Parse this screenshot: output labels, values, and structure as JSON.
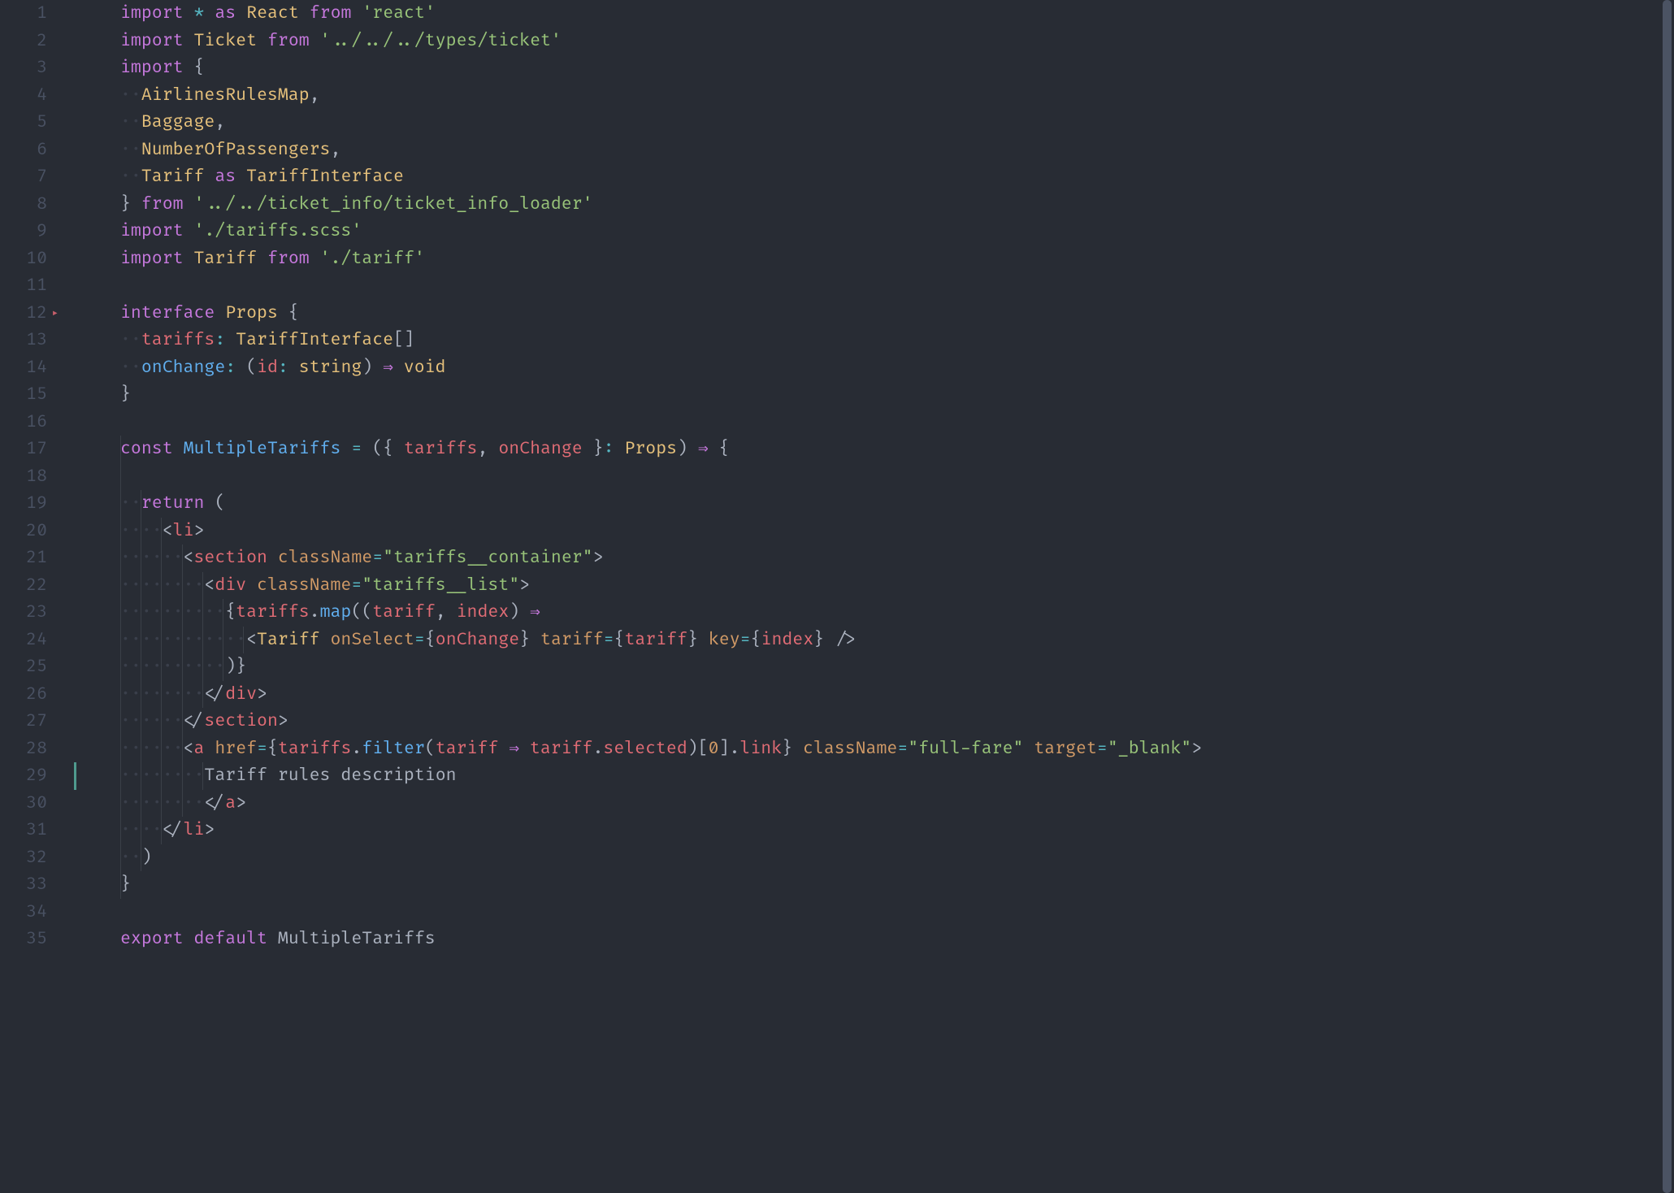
{
  "editor": {
    "first_line": 1,
    "last_line": 35,
    "gutter_marker_line": 12,
    "change_bar_line": 29,
    "indent_char": "·",
    "lines": [
      {
        "n": 1,
        "tokens": [
          [
            "kw",
            "import"
          ],
          [
            "punct",
            " "
          ],
          [
            "op",
            "*"
          ],
          [
            "punct",
            " "
          ],
          [
            "kw",
            "as"
          ],
          [
            "punct",
            " "
          ],
          [
            "type",
            "React"
          ],
          [
            "punct",
            " "
          ],
          [
            "kw",
            "from"
          ],
          [
            "punct",
            " "
          ],
          [
            "str",
            "'react'"
          ]
        ]
      },
      {
        "n": 2,
        "tokens": [
          [
            "kw",
            "import"
          ],
          [
            "punct",
            " "
          ],
          [
            "type",
            "Ticket"
          ],
          [
            "punct",
            " "
          ],
          [
            "kw",
            "from"
          ],
          [
            "punct",
            " "
          ],
          [
            "str",
            "'../../../types/ticket'"
          ]
        ]
      },
      {
        "n": 3,
        "tokens": [
          [
            "kw",
            "import"
          ],
          [
            "punct",
            " {"
          ]
        ]
      },
      {
        "n": 4,
        "indent": 2,
        "tokens": [
          [
            "type",
            "AirlinesRulesMap"
          ],
          [
            "punct",
            ","
          ]
        ]
      },
      {
        "n": 5,
        "indent": 2,
        "tokens": [
          [
            "type",
            "Baggage"
          ],
          [
            "punct",
            ","
          ]
        ]
      },
      {
        "n": 6,
        "indent": 2,
        "tokens": [
          [
            "type",
            "NumberOfPassengers"
          ],
          [
            "punct",
            ","
          ]
        ]
      },
      {
        "n": 7,
        "indent": 2,
        "tokens": [
          [
            "type",
            "Tariff"
          ],
          [
            "punct",
            " "
          ],
          [
            "kw",
            "as"
          ],
          [
            "punct",
            " "
          ],
          [
            "type",
            "TariffInterface"
          ]
        ]
      },
      {
        "n": 8,
        "tokens": [
          [
            "punct",
            "} "
          ],
          [
            "kw",
            "from"
          ],
          [
            "punct",
            " "
          ],
          [
            "str",
            "'../../ticket_info/ticket_info_loader'"
          ]
        ]
      },
      {
        "n": 9,
        "tokens": [
          [
            "kw",
            "import"
          ],
          [
            "punct",
            " "
          ],
          [
            "str",
            "'./tariffs.scss'"
          ]
        ]
      },
      {
        "n": 10,
        "tokens": [
          [
            "kw",
            "import"
          ],
          [
            "punct",
            " "
          ],
          [
            "type",
            "Tariff"
          ],
          [
            "punct",
            " "
          ],
          [
            "kw",
            "from"
          ],
          [
            "punct",
            " "
          ],
          [
            "str",
            "'./tariff'"
          ]
        ]
      },
      {
        "n": 11,
        "tokens": []
      },
      {
        "n": 12,
        "tokens": [
          [
            "kw",
            "interface"
          ],
          [
            "punct",
            " "
          ],
          [
            "type",
            "Props"
          ],
          [
            "punct",
            " {"
          ]
        ]
      },
      {
        "n": 13,
        "indent": 2,
        "tokens": [
          [
            "prop",
            "tariffs"
          ],
          [
            "op",
            ":"
          ],
          [
            "punct",
            " "
          ],
          [
            "type",
            "TariffInterface"
          ],
          [
            "punct",
            "[]"
          ]
        ]
      },
      {
        "n": 14,
        "indent": 2,
        "tokens": [
          [
            "fn",
            "onChange"
          ],
          [
            "op",
            ":"
          ],
          [
            "punct",
            " ("
          ],
          [
            "var",
            "id"
          ],
          [
            "op",
            ":"
          ],
          [
            "punct",
            " "
          ],
          [
            "type",
            "string"
          ],
          [
            "punct",
            ") "
          ],
          [
            "kw",
            "⇒"
          ],
          [
            "punct",
            " "
          ],
          [
            "type",
            "void"
          ]
        ]
      },
      {
        "n": 15,
        "tokens": [
          [
            "punct",
            "}"
          ]
        ]
      },
      {
        "n": 16,
        "tokens": []
      },
      {
        "n": 17,
        "tokens": [
          [
            "kw",
            "const"
          ],
          [
            "punct",
            " "
          ],
          [
            "fn",
            "MultipleTariffs"
          ],
          [
            "punct",
            " "
          ],
          [
            "op",
            "="
          ],
          [
            "punct",
            " ({ "
          ],
          [
            "var",
            "tariffs"
          ],
          [
            "punct",
            ", "
          ],
          [
            "var",
            "onChange"
          ],
          [
            "punct",
            " }"
          ],
          [
            "op",
            ":"
          ],
          [
            "punct",
            " "
          ],
          [
            "type",
            "Props"
          ],
          [
            "punct",
            ") "
          ],
          [
            "kw",
            "⇒"
          ],
          [
            "punct",
            " {"
          ]
        ]
      },
      {
        "n": 18,
        "tokens": []
      },
      {
        "n": 19,
        "indent": 2,
        "tokens": [
          [
            "kw",
            "return"
          ],
          [
            "punct",
            " ("
          ]
        ]
      },
      {
        "n": 20,
        "indent": 4,
        "tokens": [
          [
            "tagbr",
            "<"
          ],
          [
            "tag",
            "li"
          ],
          [
            "tagbr",
            ">"
          ]
        ]
      },
      {
        "n": 21,
        "indent": 6,
        "tokens": [
          [
            "tagbr",
            "<"
          ],
          [
            "tag",
            "section"
          ],
          [
            "punct",
            " "
          ],
          [
            "attr",
            "className"
          ],
          [
            "op",
            "="
          ],
          [
            "str",
            "\"tariffs__container\""
          ],
          [
            "tagbr",
            ">"
          ]
        ]
      },
      {
        "n": 22,
        "indent": 8,
        "tokens": [
          [
            "tagbr",
            "<"
          ],
          [
            "tag",
            "div"
          ],
          [
            "punct",
            " "
          ],
          [
            "attr",
            "className"
          ],
          [
            "op",
            "="
          ],
          [
            "str",
            "\"tariffs__list\""
          ],
          [
            "tagbr",
            ">"
          ]
        ]
      },
      {
        "n": 23,
        "indent": 10,
        "tokens": [
          [
            "punct",
            "{"
          ],
          [
            "var",
            "tariffs"
          ],
          [
            "punct",
            "."
          ],
          [
            "fn",
            "map"
          ],
          [
            "punct",
            "(("
          ],
          [
            "var",
            "tariff"
          ],
          [
            "punct",
            ", "
          ],
          [
            "var",
            "index"
          ],
          [
            "punct",
            ") "
          ],
          [
            "kw",
            "⇒"
          ]
        ]
      },
      {
        "n": 24,
        "indent": 12,
        "tokens": [
          [
            "tagbr",
            "<"
          ],
          [
            "type",
            "Tariff"
          ],
          [
            "punct",
            " "
          ],
          [
            "attr",
            "onSelect"
          ],
          [
            "op",
            "="
          ],
          [
            "punct",
            "{"
          ],
          [
            "var",
            "onChange"
          ],
          [
            "punct",
            "}"
          ],
          [
            "punct",
            " "
          ],
          [
            "attr",
            "tariff"
          ],
          [
            "op",
            "="
          ],
          [
            "punct",
            "{"
          ],
          [
            "var",
            "tariff"
          ],
          [
            "punct",
            "}"
          ],
          [
            "punct",
            " "
          ],
          [
            "attr",
            "key"
          ],
          [
            "op",
            "="
          ],
          [
            "punct",
            "{"
          ],
          [
            "var",
            "index"
          ],
          [
            "punct",
            "}"
          ],
          [
            "punct",
            " "
          ],
          [
            "tagbr",
            "/>"
          ]
        ]
      },
      {
        "n": 25,
        "indent": 10,
        "tokens": [
          [
            "punct",
            ")}"
          ]
        ]
      },
      {
        "n": 26,
        "indent": 8,
        "tokens": [
          [
            "tagbr",
            "</"
          ],
          [
            "tag",
            "div"
          ],
          [
            "tagbr",
            ">"
          ]
        ]
      },
      {
        "n": 27,
        "indent": 6,
        "tokens": [
          [
            "tagbr",
            "</"
          ],
          [
            "tag",
            "section"
          ],
          [
            "tagbr",
            ">"
          ]
        ]
      },
      {
        "n": 28,
        "indent": 6,
        "tokens": [
          [
            "tagbr",
            "<"
          ],
          [
            "tag",
            "a"
          ],
          [
            "punct",
            " "
          ],
          [
            "attr",
            "href"
          ],
          [
            "op",
            "="
          ],
          [
            "punct",
            "{"
          ],
          [
            "var",
            "tariffs"
          ],
          [
            "punct",
            "."
          ],
          [
            "fn",
            "filter"
          ],
          [
            "punct",
            "("
          ],
          [
            "var",
            "tariff"
          ],
          [
            "punct",
            " "
          ],
          [
            "kw",
            "⇒"
          ],
          [
            "punct",
            " "
          ],
          [
            "var",
            "tariff"
          ],
          [
            "punct",
            "."
          ],
          [
            "prop",
            "selected"
          ],
          [
            "punct",
            ")["
          ],
          [
            "num",
            "0"
          ],
          [
            "punct",
            "]."
          ],
          [
            "prop",
            "link"
          ],
          [
            "punct",
            "}"
          ],
          [
            "punct",
            " "
          ],
          [
            "attr",
            "className"
          ],
          [
            "op",
            "="
          ],
          [
            "str",
            "\"full-fare\""
          ],
          [
            "punct",
            " "
          ],
          [
            "attr",
            "target"
          ],
          [
            "op",
            "="
          ],
          [
            "str",
            "\"_blank\""
          ],
          [
            "tagbr",
            ">"
          ]
        ]
      },
      {
        "n": 29,
        "indent": 8,
        "tokens": [
          [
            "ident",
            "Tariff rules description"
          ]
        ]
      },
      {
        "n": 30,
        "indent": 8,
        "tokens": [
          [
            "tagbr",
            "</"
          ],
          [
            "tag",
            "a"
          ],
          [
            "tagbr",
            ">"
          ]
        ]
      },
      {
        "n": 31,
        "indent": 4,
        "tokens": [
          [
            "tagbr",
            "</"
          ],
          [
            "tag",
            "li"
          ],
          [
            "tagbr",
            ">"
          ]
        ]
      },
      {
        "n": 32,
        "indent": 2,
        "tokens": [
          [
            "punct",
            ")"
          ]
        ]
      },
      {
        "n": 33,
        "tokens": [
          [
            "punct",
            "}"
          ]
        ]
      },
      {
        "n": 34,
        "tokens": []
      },
      {
        "n": 35,
        "tokens": [
          [
            "kw",
            "export"
          ],
          [
            "punct",
            " "
          ],
          [
            "kw",
            "default"
          ],
          [
            "punct",
            " "
          ],
          [
            "ident",
            "MultipleTariffs"
          ]
        ]
      }
    ]
  },
  "guides": {
    "17_33": [
      0
    ],
    "19_32": [
      0,
      1
    ],
    "20_31": [
      0,
      1,
      2
    ],
    "21_27": [
      0,
      1,
      2,
      3
    ],
    "22_26": [
      0,
      1,
      2,
      3,
      4
    ],
    "23_25": [
      0,
      1,
      2,
      3,
      4,
      5
    ],
    "24": [
      0,
      1,
      2,
      3,
      4,
      5,
      6
    ],
    "28_30": [
      0,
      1,
      2,
      3
    ],
    "29": [
      0,
      1,
      2,
      3,
      4
    ]
  }
}
